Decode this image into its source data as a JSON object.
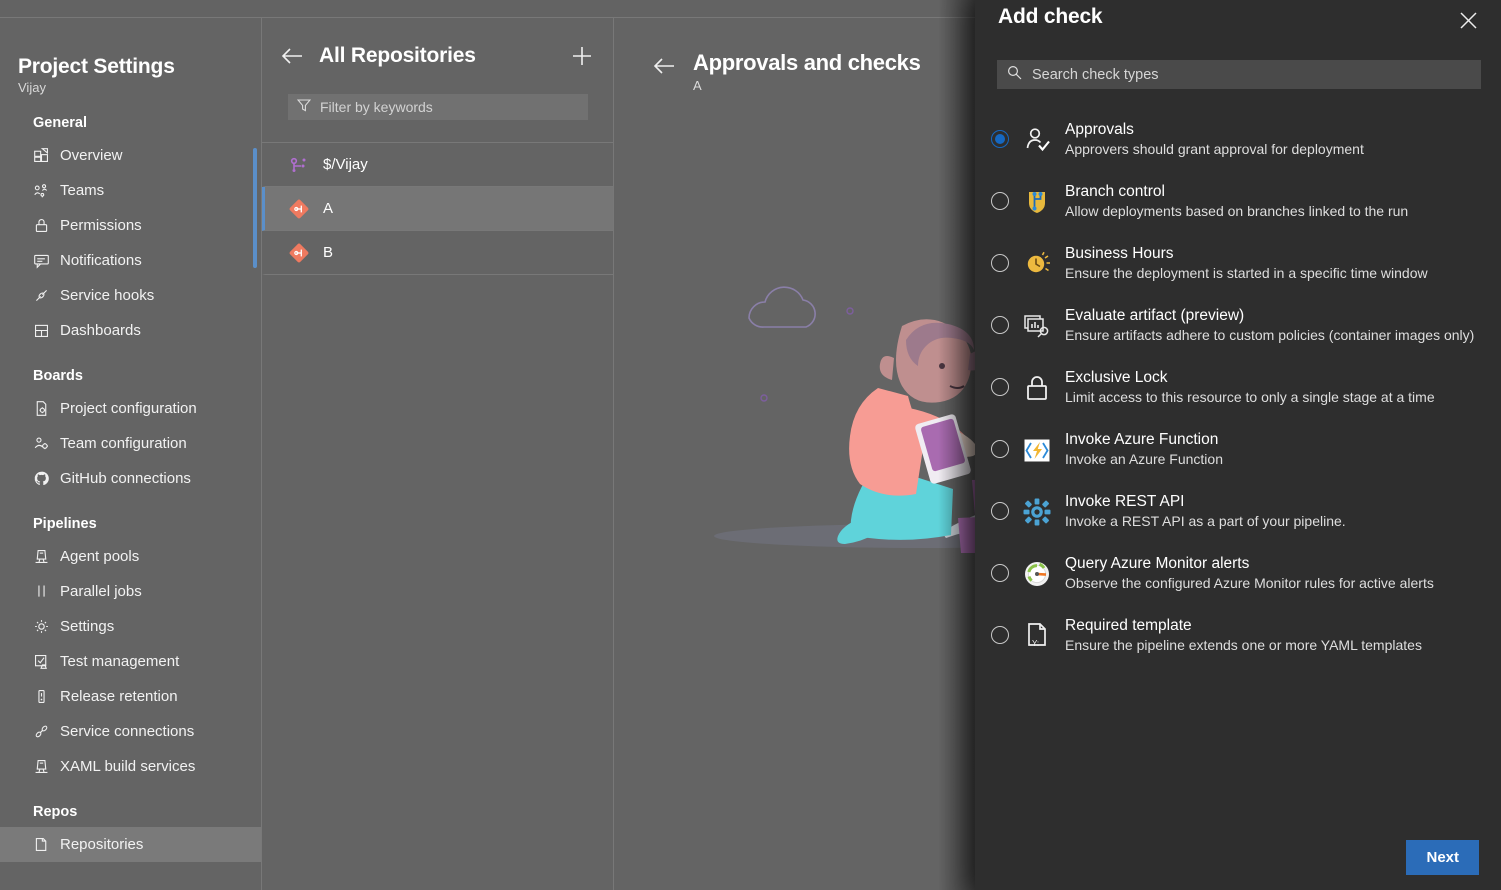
{
  "top_strip": {
    "cutoff_text": "···  ·  ·  ···  ·  ·· ··   ···  ·· ·"
  },
  "sidebar": {
    "title": "Project Settings",
    "subtitle": "Vijay",
    "groups": [
      {
        "title": "General",
        "items": [
          {
            "label": "Overview",
            "icon": "overview-icon"
          },
          {
            "label": "Teams",
            "icon": "teams-icon"
          },
          {
            "label": "Permissions",
            "icon": "lock-icon"
          },
          {
            "label": "Notifications",
            "icon": "notifications-icon"
          },
          {
            "label": "Service hooks",
            "icon": "plug-icon"
          },
          {
            "label": "Dashboards",
            "icon": "dashboards-icon"
          }
        ]
      },
      {
        "title": "Boards",
        "items": [
          {
            "label": "Project configuration",
            "icon": "document-gear-icon"
          },
          {
            "label": "Team configuration",
            "icon": "team-gear-icon"
          },
          {
            "label": "GitHub connections",
            "icon": "github-icon"
          }
        ]
      },
      {
        "title": "Pipelines",
        "items": [
          {
            "label": "Agent pools",
            "icon": "agent-pool-icon"
          },
          {
            "label": "Parallel jobs",
            "icon": "parallel-jobs-icon"
          },
          {
            "label": "Settings",
            "icon": "gear-icon"
          },
          {
            "label": "Test management",
            "icon": "test-management-icon"
          },
          {
            "label": "Release retention",
            "icon": "release-retention-icon"
          },
          {
            "label": "Service connections",
            "icon": "service-connections-icon"
          },
          {
            "label": "XAML build services",
            "icon": "xaml-build-icon"
          }
        ]
      },
      {
        "title": "Repos",
        "items": [
          {
            "label": "Repositories",
            "icon": "repositories-icon",
            "selected": true
          }
        ]
      }
    ]
  },
  "repos_panel": {
    "title": "All Repositories",
    "back_label": "Back",
    "add_label": "Add",
    "filter_placeholder": "Filter by keywords",
    "rows": [
      {
        "name": "$/Vijay",
        "icon": "tfvc-icon",
        "selected": false
      },
      {
        "name": "A",
        "icon": "git-repo-icon",
        "selected": true
      },
      {
        "name": "B",
        "icon": "git-repo-icon",
        "selected": false
      }
    ]
  },
  "main": {
    "title": "Approvals and checks",
    "subtitle": "A",
    "back_label": "Back",
    "illustration": "person-stacking-cups-with-dog-illustration"
  },
  "flyout": {
    "title": "Add check",
    "close_label": "Close",
    "search_placeholder": "Search check types",
    "next_label": "Next",
    "accent_color": "#2b6cb8",
    "radio_selected_color": "#1668c1",
    "checks": [
      {
        "name": "Approvals",
        "description": "Approvers should grant approval for deployment",
        "icon": "approvals-icon",
        "selected": true
      },
      {
        "name": "Branch control",
        "description": "Allow deployments based on branches linked to the run",
        "icon": "branch-control-icon",
        "selected": false
      },
      {
        "name": "Business Hours",
        "description": "Ensure the deployment is started in a specific time window",
        "icon": "business-hours-icon",
        "selected": false
      },
      {
        "name": "Evaluate artifact (preview)",
        "description": "Ensure artifacts adhere to custom policies (container images only)",
        "icon": "evaluate-artifact-icon",
        "selected": false
      },
      {
        "name": "Exclusive Lock",
        "description": "Limit access to this resource to only a single stage at a time",
        "icon": "exclusive-lock-icon",
        "selected": false
      },
      {
        "name": "Invoke Azure Function",
        "description": "Invoke an Azure Function",
        "icon": "azure-function-icon",
        "selected": false
      },
      {
        "name": "Invoke REST API",
        "description": "Invoke a REST API as a part of your pipeline.",
        "icon": "rest-api-icon",
        "selected": false
      },
      {
        "name": "Query Azure Monitor alerts",
        "description": "Observe the configured Azure Monitor rules for active alerts",
        "icon": "azure-monitor-icon",
        "selected": false
      },
      {
        "name": "Required template",
        "description": "Ensure the pipeline extends one or more YAML templates",
        "icon": "required-template-icon",
        "selected": false
      }
    ]
  }
}
